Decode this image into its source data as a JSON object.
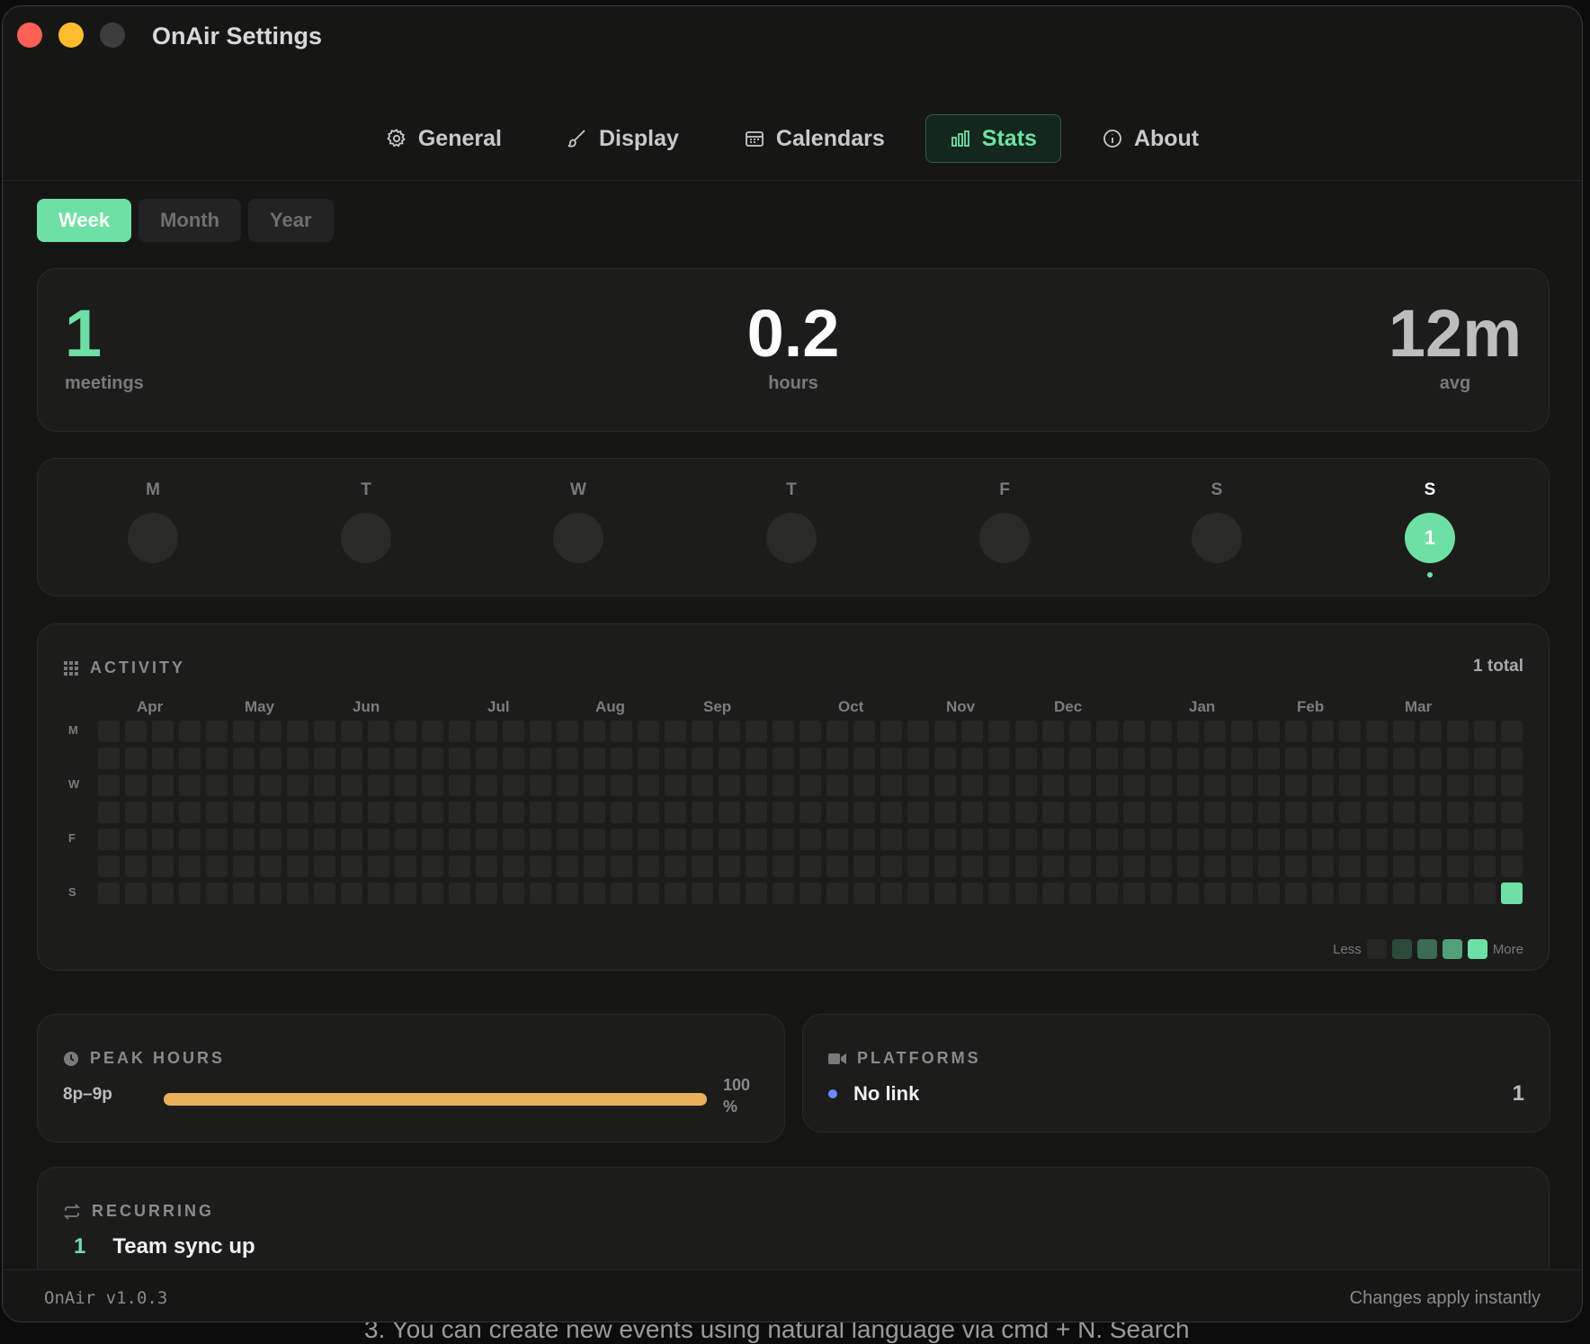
{
  "background_text": "3. You can create new events using natural language via cmd + N. Search",
  "window": {
    "title": "OnAir Settings"
  },
  "tabs": [
    {
      "label": "General",
      "icon": "gear-icon",
      "active": false
    },
    {
      "label": "Display",
      "icon": "brush-icon",
      "active": false
    },
    {
      "label": "Calendars",
      "icon": "calendar-icon",
      "active": false
    },
    {
      "label": "Stats",
      "icon": "bar-chart-icon",
      "active": true
    },
    {
      "label": "About",
      "icon": "info-icon",
      "active": false
    }
  ],
  "range": {
    "options": [
      "Week",
      "Month",
      "Year"
    ],
    "selected": "Week"
  },
  "summary": {
    "meetings": {
      "value": "1",
      "label": "meetings"
    },
    "hours": {
      "value": "0.2",
      "label": "hours"
    },
    "avg": {
      "value": "12m",
      "label": "avg"
    }
  },
  "week_days": [
    {
      "label": "M",
      "count": ""
    },
    {
      "label": "T",
      "count": ""
    },
    {
      "label": "W",
      "count": ""
    },
    {
      "label": "T",
      "count": ""
    },
    {
      "label": "F",
      "count": ""
    },
    {
      "label": "S",
      "count": ""
    },
    {
      "label": "S",
      "count": "1",
      "active": true
    }
  ],
  "activity": {
    "title": "ACTIVITY",
    "total": "1 total",
    "months": [
      {
        "label": "Apr",
        "week": 1
      },
      {
        "label": "May",
        "week": 5
      },
      {
        "label": "Jun",
        "week": 9
      },
      {
        "label": "Jul",
        "week": 14
      },
      {
        "label": "Aug",
        "week": 18
      },
      {
        "label": "Sep",
        "week": 22
      },
      {
        "label": "Oct",
        "week": 27
      },
      {
        "label": "Nov",
        "week": 31
      },
      {
        "label": "Dec",
        "week": 35
      },
      {
        "label": "Jan",
        "week": 40
      },
      {
        "label": "Feb",
        "week": 44
      },
      {
        "label": "Mar",
        "week": 48
      }
    ],
    "day_labels": [
      "M",
      "W",
      "F",
      "S"
    ],
    "weeks": 53,
    "days_per_week": 7,
    "active_cells": [
      {
        "week": 52,
        "day": 6,
        "level": 4
      }
    ],
    "legend": {
      "less": "Less",
      "more": "More"
    },
    "colors": [
      "#262625",
      "#2c4a39",
      "#3d6b52",
      "#52a07a",
      "#6fe0a4"
    ]
  },
  "peak_hours": {
    "title": "PEAK HOURS",
    "label": "8p–9p",
    "percent": 100,
    "percent_text": "100 %",
    "color": "#e8b35b"
  },
  "platforms": {
    "title": "PLATFORMS",
    "items": [
      {
        "name": "No link",
        "count": "1",
        "color": "#6a8cff"
      }
    ]
  },
  "recurring": {
    "title": "RECURRING",
    "items": [
      {
        "count": "1",
        "name": "Team sync up"
      }
    ]
  },
  "footer": {
    "version": "OnAir v1.0.3",
    "note": "Changes apply instantly"
  },
  "accent": "#6fe0a4"
}
